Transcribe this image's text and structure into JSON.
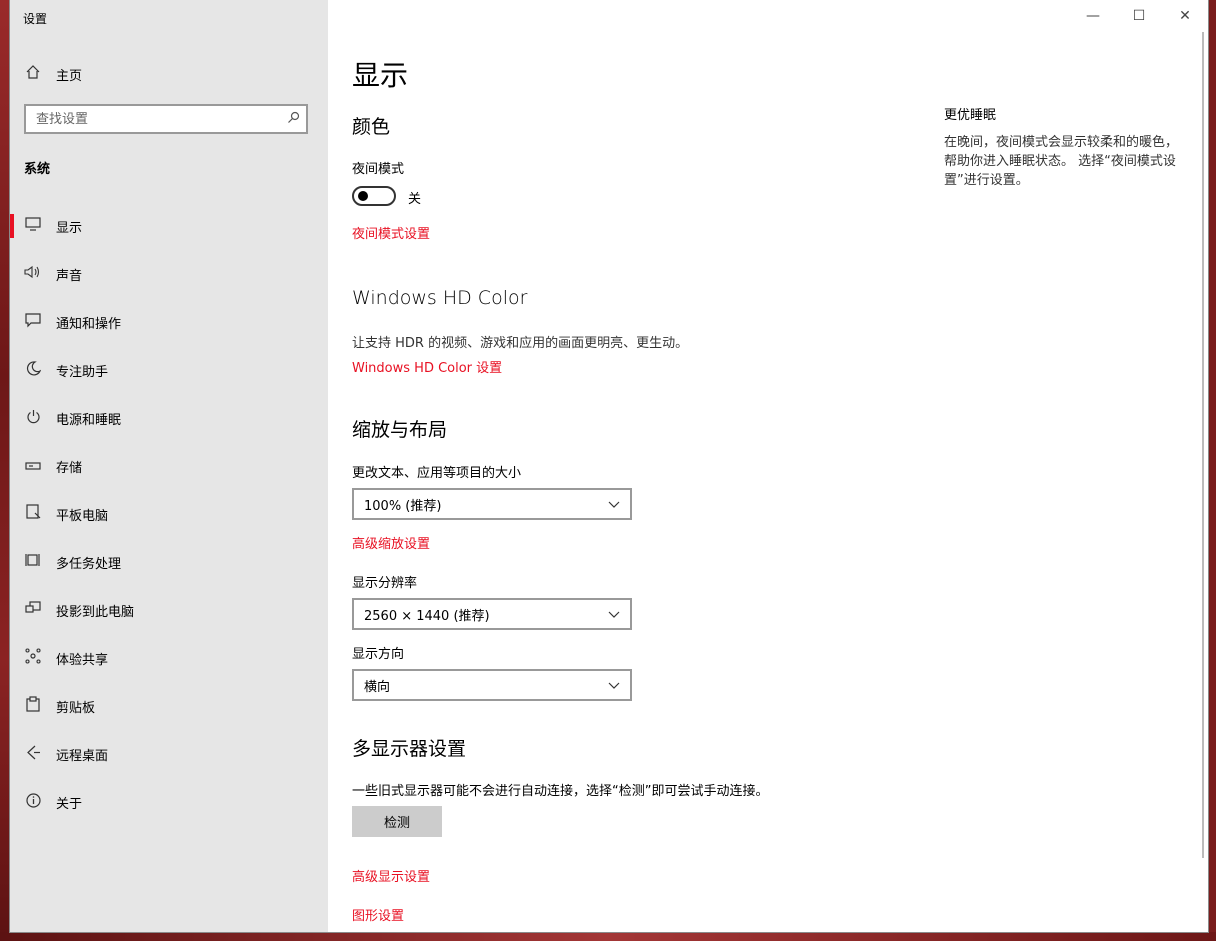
{
  "window": {
    "title": "设置",
    "caption": {
      "minimize": "—",
      "maximize": "☐",
      "close": "✕"
    }
  },
  "sidebar": {
    "home": {
      "icon": "home-icon",
      "label": "主页"
    },
    "search": {
      "placeholder": "查找设置"
    },
    "section": "系统",
    "items": [
      {
        "icon": "monitor-icon",
        "label": "显示",
        "active": true
      },
      {
        "icon": "speaker-icon",
        "label": "声音"
      },
      {
        "icon": "notification-icon",
        "label": "通知和操作"
      },
      {
        "icon": "moon-icon",
        "label": "专注助手"
      },
      {
        "icon": "power-icon",
        "label": "电源和睡眠"
      },
      {
        "icon": "storage-icon",
        "label": "存储"
      },
      {
        "icon": "tablet-icon",
        "label": "平板电脑"
      },
      {
        "icon": "multitask-icon",
        "label": "多任务处理"
      },
      {
        "icon": "project-icon",
        "label": "投影到此电脑"
      },
      {
        "icon": "share-icon",
        "label": "体验共享"
      },
      {
        "icon": "clipboard-icon",
        "label": "剪贴板"
      },
      {
        "icon": "remote-icon",
        "label": "远程桌面"
      },
      {
        "icon": "info-icon",
        "label": "关于"
      }
    ]
  },
  "main": {
    "title": "显示",
    "color": {
      "heading": "颜色",
      "night_mode_label": "夜间模式",
      "night_mode_state": "关",
      "night_mode_link": "夜间模式设置"
    },
    "hdr": {
      "heading": "Windows HD Color",
      "description": "让支持 HDR 的视频、游戏和应用的画面更明亮、更生动。",
      "link": "Windows HD Color 设置"
    },
    "scale": {
      "heading": "缩放与布局",
      "size_label": "更改文本、应用等项目的大小",
      "size_value": "100% (推荐)",
      "advanced_link": "高级缩放设置",
      "resolution_label": "显示分辨率",
      "resolution_value": "2560 × 1440 (推荐)",
      "orientation_label": "显示方向",
      "orientation_value": "横向"
    },
    "multi": {
      "heading": "多显示器设置",
      "description": "一些旧式显示器可能不会进行自动连接，选择“检测”即可尝试手动连接。",
      "detect_button": "检测",
      "advanced_display_link": "高级显示设置",
      "graphics_link": "图形设置"
    },
    "aside": {
      "title": "更优睡眠",
      "text": "在晚间，夜间模式会显示较柔和的暖色，帮助你进入睡眠状态。 选择“夜间模式设置”进行设置。"
    }
  }
}
